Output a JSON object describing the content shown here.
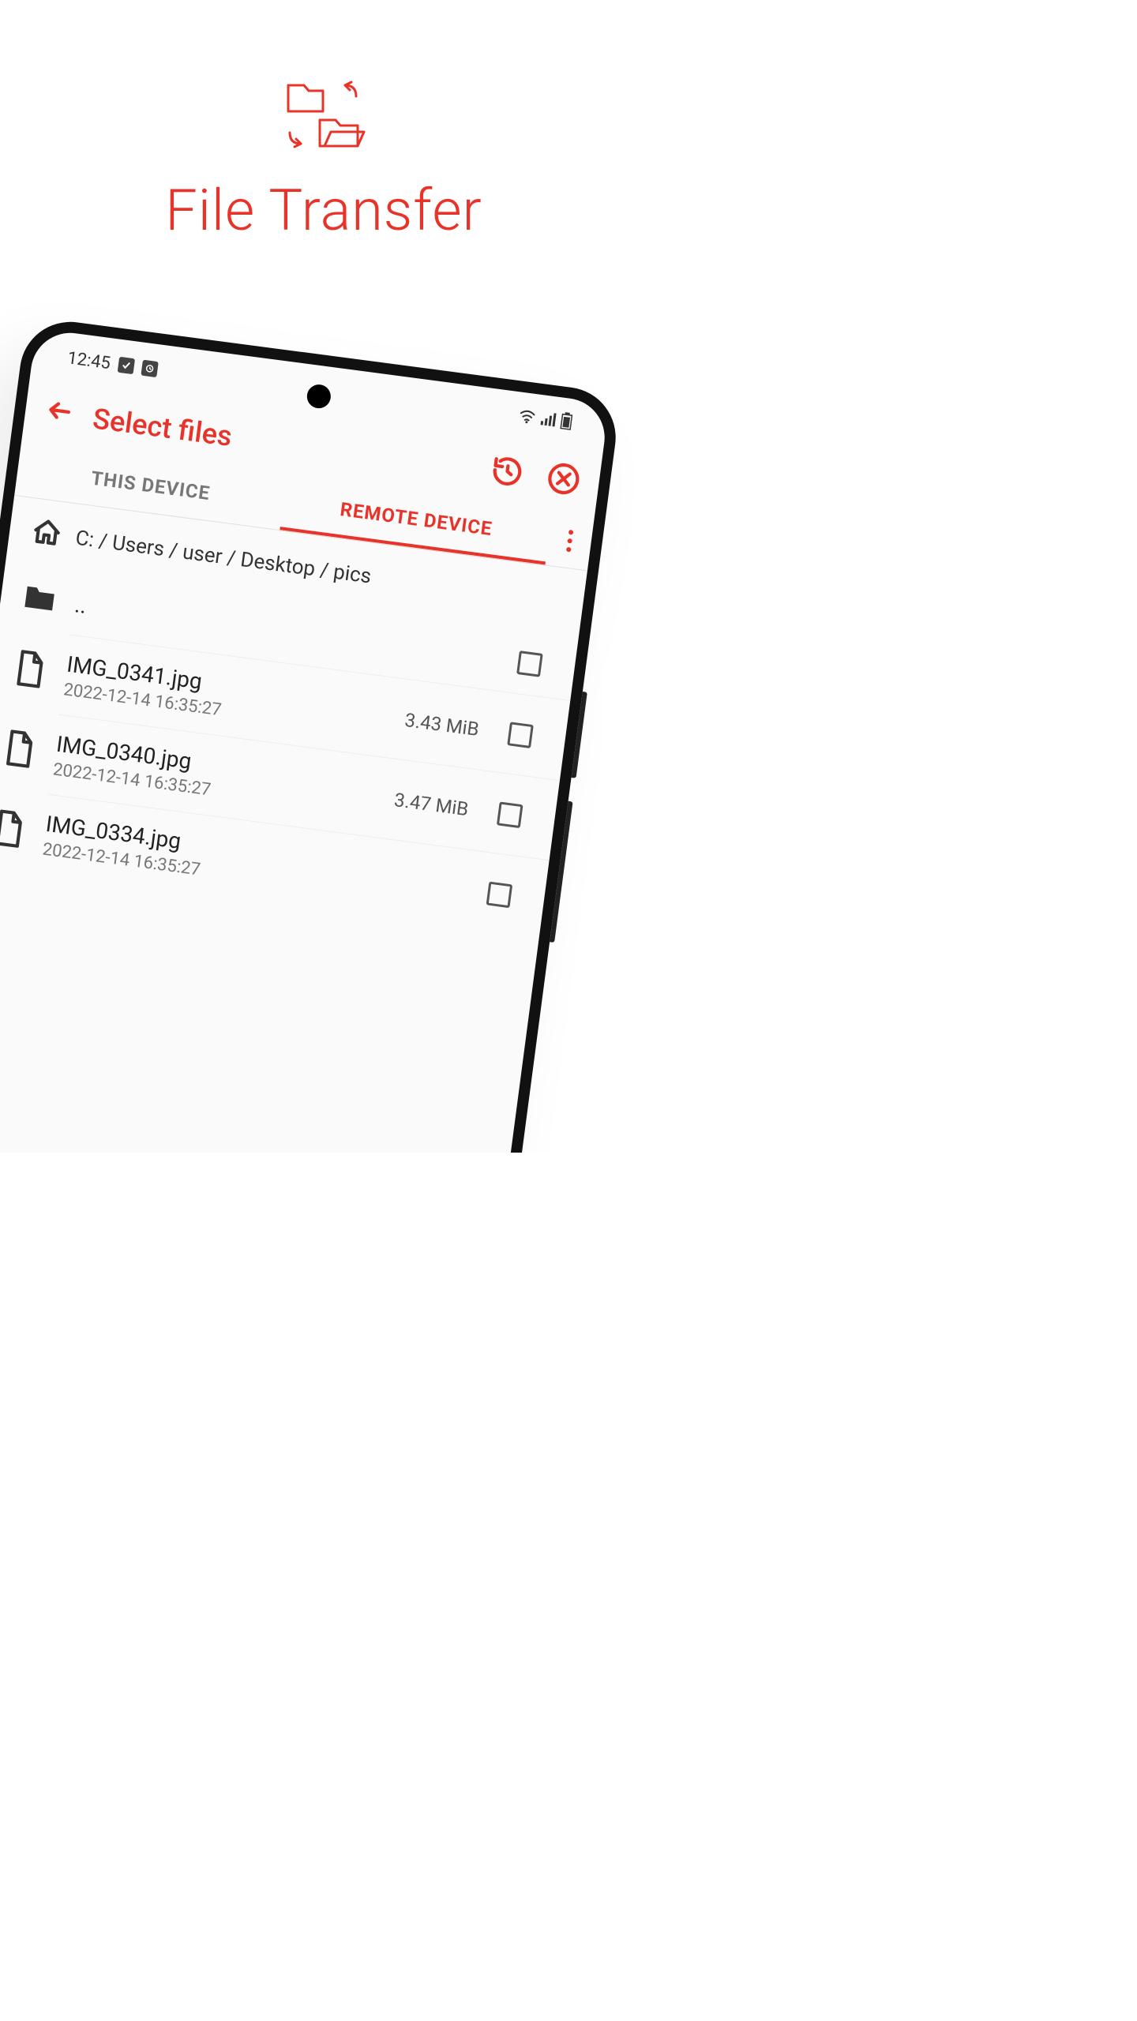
{
  "hero": {
    "title": "File Transfer"
  },
  "statusbar": {
    "time": "12:45"
  },
  "appbar": {
    "title": "Select files"
  },
  "tabs": {
    "this_device": "THIS DEVICE",
    "remote_device": "REMOTE DEVICE"
  },
  "path": {
    "breadcrumb": "C: / Users / user / Desktop / pics"
  },
  "rows": {
    "up": {
      "name": ".."
    },
    "r0": {
      "name": "IMG_0341.jpg",
      "date": "2022-12-14 16:35:27",
      "size": "3.43 MiB"
    },
    "r1": {
      "name": "IMG_0340.jpg",
      "date": "2022-12-14 16:35:27",
      "size": "3.47 MiB"
    },
    "r2": {
      "name": "IMG_0334.jpg",
      "date": "2022-12-14 16:35:27",
      "size": ""
    }
  }
}
